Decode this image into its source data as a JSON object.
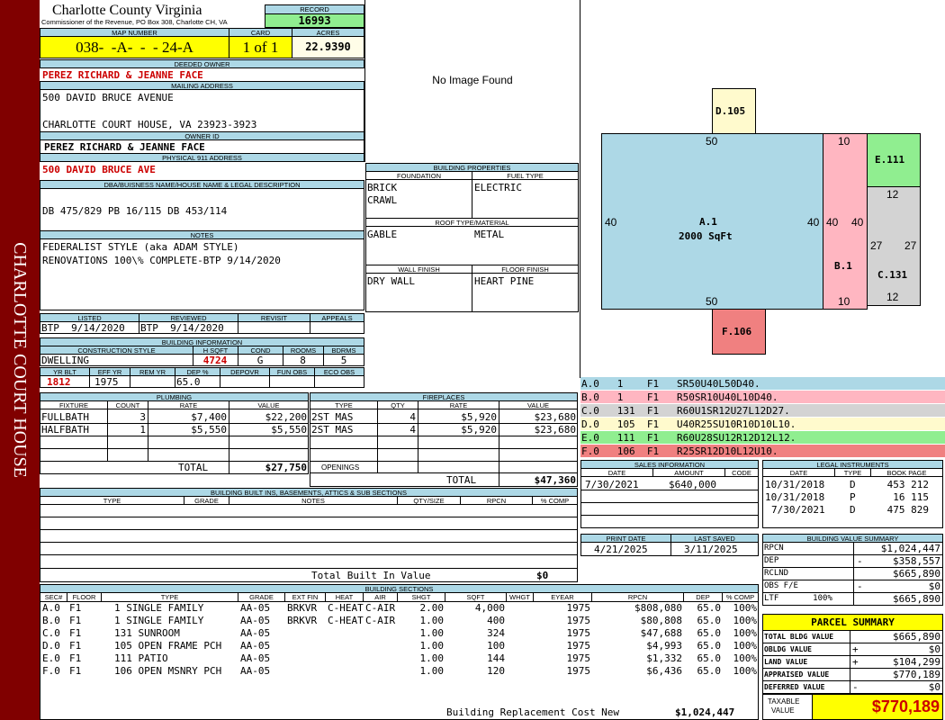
{
  "sidebar": {
    "text": "CHARLOTTE COURT HOUSE"
  },
  "header": {
    "county": "Charlotte County Virginia",
    "commissioner": "Commissioner of the Revenue, PO Box 308, Charlotte CH, VA",
    "record_label": "RECORD",
    "record": "16993",
    "map_label": "MAP NUMBER",
    "map": "038-  -A-  -  - 24-A",
    "card_label": "CARD",
    "card": "1 of 1",
    "acres_label": "ACRES",
    "acres": "22.9390"
  },
  "owner": {
    "deeded_label": "DEEDED OWNER",
    "deeded": "PEREZ RICHARD & JEANNE FACE",
    "mailing_label": "MAILING ADDRESS",
    "mail1": "500 DAVID BRUCE AVENUE",
    "mail2": "CHARLOTTE COURT HOUSE, VA 23923-3923",
    "owner_id_label": "OWNER ID",
    "owner_id": "PEREZ RICHARD & JEANNE FACE",
    "physical_label": "PHYSICAL 911 ADDRESS",
    "physical": "500 DAVID BRUCE AVE"
  },
  "dba": {
    "label": "DBA/BUISNESS NAME/HOUSE NAME & LEGAL DESCRIPTION",
    "text": "DB 475/829 PB 16/115 DB 453/114"
  },
  "notes": {
    "label": "NOTES",
    "line1": "FEDERALIST STYLE (aka ADAM STYLE)",
    "line2": "RENOVATIONS 100\\% COMPLETE-BTP 9/14/2020"
  },
  "listed": {
    "listed_label": "LISTED",
    "reviewed_label": "REVIEWED",
    "revisit_label": "REVISIT",
    "appeals_label": "APPEALS",
    "listed": "BTP  9/14/2020",
    "reviewed": "BTP  9/14/2020"
  },
  "bldg_info": {
    "label": "BUILDING INFORMATION",
    "style_label": "CONSTRUCTION STYLE",
    "hsqft_label": "H SQFT",
    "cond_label": "COND",
    "rooms_label": "ROOMS",
    "bdrms_label": "BDRMS",
    "style": "DWELLING",
    "hsqft": "4724",
    "cond": "G",
    "rooms": "8",
    "bdrms": "5",
    "yrblt_label": "YR BLT",
    "effyr_label": "EFF YR",
    "remyr_label": "REM YR",
    "dep_label": "DEP %",
    "depovr_label": "DEPOVR",
    "funobs_label": "FUN OBS",
    "ecoobs_label": "ECO OBS",
    "yrblt": "1812",
    "effyr": "1975",
    "dep": "65.0"
  },
  "plumbing": {
    "label": "PLUMBING",
    "cols": [
      "FIXTURE",
      "COUNT",
      "RATE",
      "VALUE"
    ],
    "rows": [
      [
        "FULLBATH",
        "3",
        "$7,400",
        "$22,200"
      ],
      [
        "HALFBATH",
        "1",
        "$5,550",
        "$5,550"
      ]
    ],
    "total_label": "TOTAL",
    "total": "$27,750"
  },
  "fireplaces": {
    "label": "FIREPLACES",
    "cols": [
      "TYPE",
      "QTY",
      "RATE",
      "VALUE"
    ],
    "rows": [
      [
        "2ST MAS",
        "4",
        "$5,920",
        "$23,680"
      ],
      [
        "2ST MAS",
        "4",
        "$5,920",
        "$23,680"
      ]
    ],
    "openings_label": "OPENINGS",
    "total_label": "TOTAL",
    "total": "$47,360"
  },
  "image": {
    "text": "No Image Found"
  },
  "props": {
    "label": "BUILDING PROPERTIES",
    "foundation_label": "FOUNDATION",
    "fuel_label": "FUEL TYPE",
    "foundation1": "BRICK",
    "foundation2": "CRAWL",
    "fuel": "ELECTRIC",
    "roof_label": "ROOF TYPE/MATERIAL",
    "roof1": "GABLE",
    "roof2": "METAL",
    "wall_label": "WALL FINISH",
    "floor_label": "FLOOR FINISH",
    "wall": "DRY WALL",
    "floor": "HEART PINE"
  },
  "sketch": {
    "d105": "D.105",
    "e111": "E.111",
    "a1": "A.1",
    "a1_area": "2000 SqFt",
    "b1": "B.1",
    "c131": "C.131",
    "f106": "F.106",
    "n50top": "50",
    "n50bot": "50",
    "n40l": "40",
    "n40r": "40",
    "n40b1": "40",
    "n40b2": "40",
    "n10top": "10",
    "n10bot": "10",
    "n12top": "12",
    "n12bot": "12",
    "n27l": "27",
    "n27r": "27"
  },
  "vectors": [
    {
      "text": "A.0   1    F1   SR50U40L50D40.",
      "color": "#add8e6"
    },
    {
      "text": "B.0   1    F1   R50SR10U40L10D40.",
      "color": "#ffb6c1"
    },
    {
      "text": "C.0   131  F1   R60U1SR12U27L12D27.",
      "color": "#d3d3d3"
    },
    {
      "text": "D.0   105  F1   U40R25SU10R10D10L10.",
      "color": "#fffacd"
    },
    {
      "text": "E.0   111  F1   R60U28SU12R12D12L12.",
      "color": "#90ee90"
    },
    {
      "text": "F.0   106  F1   R25SR12D10L12U10.",
      "color": "#f08080"
    }
  ],
  "sales": {
    "label": "SALES INFORMATION",
    "date_label": "DATE",
    "amount_label": "AMOUNT",
    "code_label": "CODE",
    "date": "7/30/2021",
    "amount": "$640,000"
  },
  "legal": {
    "label": "LEGAL INSTRUMENTS",
    "date_label": "DATE",
    "type_label": "TYPE",
    "book_label": "BOOK PAGE",
    "rows": [
      [
        "10/31/2018",
        "D",
        "453 212"
      ],
      [
        "10/31/2018",
        "P",
        "16 115"
      ],
      [
        "7/30/2021",
        "D",
        "475 829"
      ]
    ]
  },
  "print": {
    "print_label": "PRINT DATE",
    "saved_label": "LAST SAVED",
    "print": "4/21/2025",
    "saved": "3/11/2025"
  },
  "value_summary": {
    "label": "BUILDING VALUE SUMMARY",
    "rows": [
      [
        "RPCN",
        "",
        "$1,024,447"
      ],
      [
        "DEP",
        "-",
        "$358,557"
      ],
      [
        "RCLND",
        "",
        "$665,890"
      ],
      [
        "OBS F/E",
        "-",
        "$0"
      ],
      [
        "LTF       100%",
        "",
        "$665,890"
      ]
    ]
  },
  "builtins": {
    "label": "BUILDING BUILT INS, BASEMENTS, ATTICS & SUB SECTIONS",
    "cols": [
      "TYPE",
      "GRADE",
      "NOTES",
      "QTY/SIZE",
      "RPCN",
      "% COMP"
    ],
    "total_label": "Total Built In Value",
    "total": "$0"
  },
  "sections": {
    "label": "BUILDING SECTIONS",
    "cols": [
      "SEC#",
      "FLOOR",
      "TYPE",
      "GRADE",
      "EXT FIN",
      "HEAT",
      "AIR",
      "SHGT",
      "SQFT",
      "WHGT",
      "EYEAR",
      "RPCN",
      "DEP",
      "% COMP"
    ],
    "rows": [
      [
        "A.0",
        "F1",
        "1 SINGLE FAMILY",
        "AA-05",
        "BRKVR",
        "C-HEAT",
        "C-AIR",
        "2.00",
        "4,000",
        "",
        "1975",
        "$808,080",
        "65.0",
        "100%"
      ],
      [
        "B.0",
        "F1",
        "1 SINGLE FAMILY",
        "AA-05",
        "BRKVR",
        "C-HEAT",
        "C-AIR",
        "1.00",
        "400",
        "",
        "1975",
        "$80,808",
        "65.0",
        "100%"
      ],
      [
        "C.0",
        "F1",
        "131 SUNROOM",
        "AA-05",
        "",
        "",
        "",
        "1.00",
        "324",
        "",
        "1975",
        "$47,688",
        "65.0",
        "100%"
      ],
      [
        "D.0",
        "F1",
        "105 OPEN FRAME PCH",
        "AA-05",
        "",
        "",
        "",
        "1.00",
        "100",
        "",
        "1975",
        "$4,993",
        "65.0",
        "100%"
      ],
      [
        "E.0",
        "F1",
        "111 PATIO",
        "AA-05",
        "",
        "",
        "",
        "1.00",
        "144",
        "",
        "1975",
        "$1,332",
        "65.0",
        "100%"
      ],
      [
        "F.0",
        "F1",
        "106 OPEN MSNRY PCH",
        "AA-05",
        "",
        "",
        "",
        "1.00",
        "120",
        "",
        "1975",
        "$6,436",
        "65.0",
        "100%"
      ]
    ],
    "replacement_label": "Building Replacement Cost New",
    "replacement": "$1,024,447"
  },
  "parcel": {
    "label": "PARCEL SUMMARY",
    "rows": [
      [
        "TOTAL BLDG VALUE",
        "",
        "$665,890"
      ],
      [
        "OBLDG VALUE",
        "+",
        "$0"
      ],
      [
        "LAND VALUE",
        "+",
        "$104,299"
      ],
      [
        "APPRAISED VALUE",
        "",
        "$770,189"
      ],
      [
        "DEFERRED VALUE",
        "-",
        "$0"
      ]
    ],
    "taxable_label1": "TAXABLE",
    "taxable_label2": "VALUE",
    "taxable": "$770,189"
  }
}
